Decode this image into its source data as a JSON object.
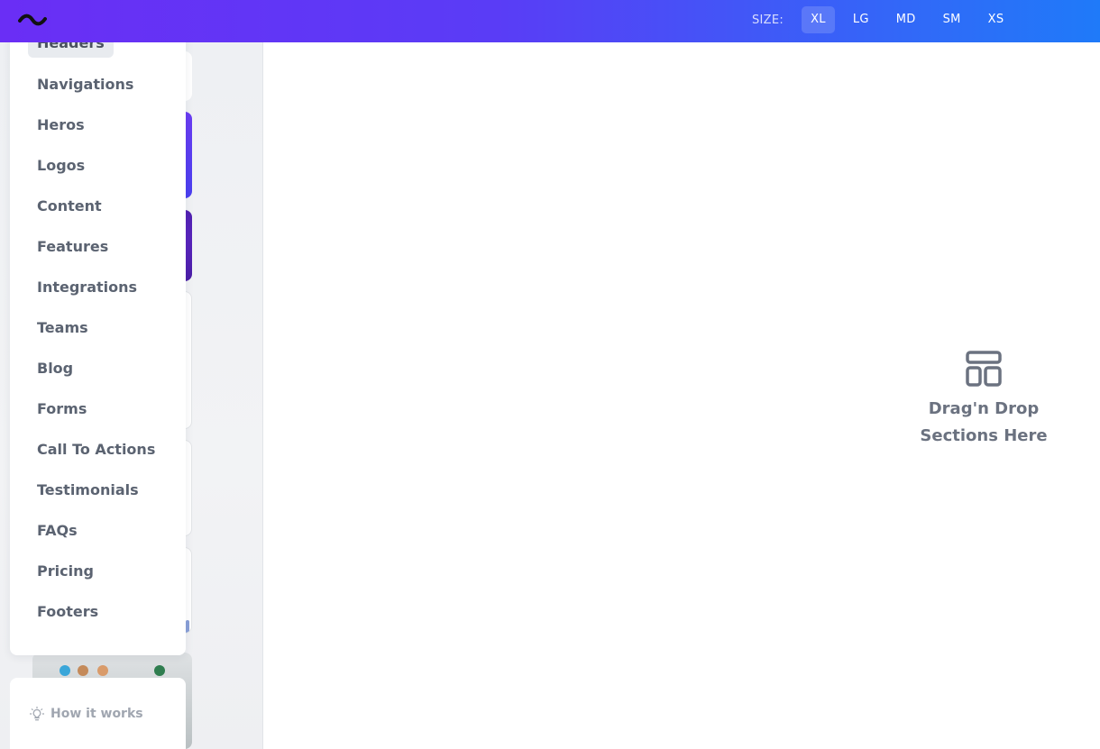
{
  "topbar": {
    "logo_icon": "wave-logo-icon",
    "size_label": "SIZE:",
    "sizes": [
      "XL",
      "LG",
      "MD",
      "SM",
      "XS"
    ],
    "active_size": "XL"
  },
  "menu": {
    "items": [
      {
        "label": "Headers"
      },
      {
        "label": "Navigations"
      },
      {
        "label": "Heros"
      },
      {
        "label": "Logos"
      },
      {
        "label": "Content"
      },
      {
        "label": "Features"
      },
      {
        "label": "Integrations"
      },
      {
        "label": "Teams"
      },
      {
        "label": "Blog"
      },
      {
        "label": "Forms"
      },
      {
        "label": "Call To Actions"
      },
      {
        "label": "Testimonials"
      },
      {
        "label": "FAQs"
      },
      {
        "label": "Pricing"
      },
      {
        "label": "Footers"
      }
    ],
    "active_item": "Headers"
  },
  "help": {
    "label": "How it works",
    "icon": "lightbulb-icon"
  },
  "canvas": {
    "drop_icon": "layout-icon",
    "drop_line1": "Drag'n Drop",
    "drop_line2": "Sections Here"
  },
  "colors": {
    "topbar_start": "#6a2ef5",
    "topbar_end": "#1f7af9",
    "menu_text": "#5b6371",
    "drop_text": "#6b7280"
  }
}
